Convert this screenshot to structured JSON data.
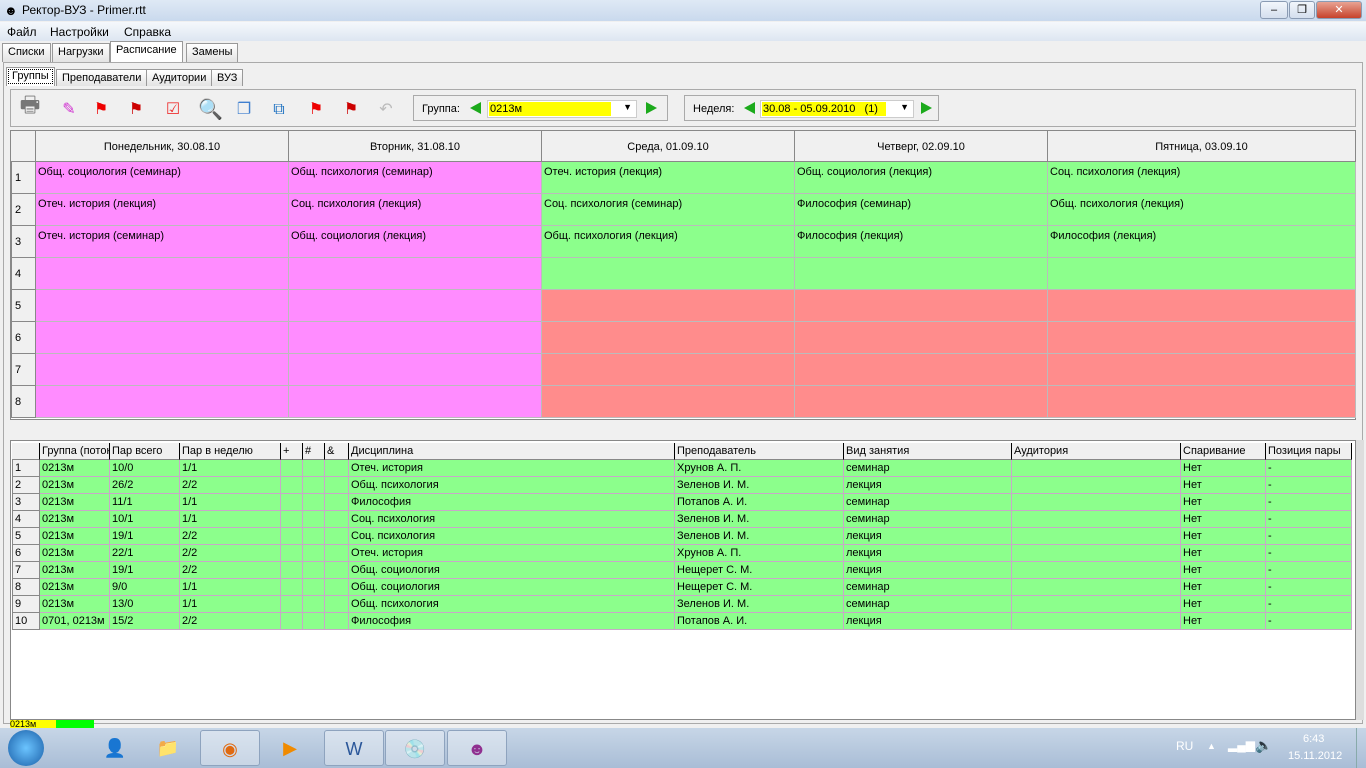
{
  "window": {
    "title": "Ректор-ВУЗ - Primer.rtt"
  },
  "menu": [
    "Файл",
    "Настройки",
    "Справка"
  ],
  "tabs": [
    "Списки",
    "Нагрузки",
    "Расписание",
    "Замены"
  ],
  "active_tab": "Расписание",
  "subtabs": [
    "Группы",
    "Преподаватели",
    "Аудитории",
    "ВУЗ"
  ],
  "active_subtab": "Группы",
  "toolbar": {
    "icons": [
      "printer-icon",
      "eraser-icon",
      "flag-icon",
      "flag-remove-icon",
      "checklist-icon",
      "magnifier-icon",
      "copy-icon",
      "export-window-icon",
      "flags-icon",
      "flags-remove-icon",
      "undo-icon"
    ],
    "group_label": "Группа:",
    "group_value": "0213м",
    "week_label": "Неделя:",
    "week_value": "30.08 - 05.09.2010   (1)"
  },
  "schedule": {
    "days": [
      "Понедельник, 30.08.10",
      "Вторник, 31.08.10",
      "Среда, 01.09.10",
      "Четверг, 02.09.10",
      "Пятница, 03.09.10"
    ],
    "rows": [
      "1",
      "2",
      "3",
      "4",
      "5",
      "6",
      "7",
      "8"
    ],
    "cells": [
      [
        "Общ. социология (семинар)",
        "Общ. психология (семинар)",
        "Отеч. история (лекция)",
        "Общ. социология (лекция)",
        "Соц. психология (лекция)"
      ],
      [
        "Отеч. история (лекция)",
        "Соц. психология (лекция)",
        "Соц. психология (семинар)",
        "Философия (семинар)",
        "Общ. психология (лекция)"
      ],
      [
        "Отеч. история (семинар)",
        "Общ. социология (лекция)",
        "Общ. психология (лекция)",
        "Философия (лекция)",
        "Философия (лекция)"
      ],
      [
        "",
        "",
        "",
        "",
        ""
      ],
      [
        "",
        "",
        "",
        "",
        ""
      ],
      [
        "",
        "",
        "",
        "",
        ""
      ],
      [
        "",
        "",
        "",
        "",
        ""
      ],
      [
        "",
        "",
        "",
        "",
        ""
      ]
    ],
    "colors": {
      "pink": "#ff8cff",
      "green": "#8cff8c",
      "red": "#ff8c8c"
    }
  },
  "table": {
    "headers": [
      "",
      "Группа (поток)",
      "Пар всего",
      "Пар в неделю",
      "+",
      "#",
      "&",
      "Дисциплина",
      "Преподаватель",
      "Вид занятия",
      "Аудитория",
      "Спаривание",
      "Позиция пары"
    ],
    "rows": [
      [
        "1",
        "0213м",
        "10/0",
        "1/1",
        "",
        "",
        "",
        "Отеч. история",
        "Хрунов А. П.",
        "семинар",
        "",
        "Нет",
        "-"
      ],
      [
        "2",
        "0213м",
        "26/2",
        "2/2",
        "",
        "",
        "",
        "Общ. психология",
        "Зеленов И. М.",
        "лекция",
        "",
        "Нет",
        "-"
      ],
      [
        "3",
        "0213м",
        "11/1",
        "1/1",
        "",
        "",
        "",
        "Философия",
        "Потапов А. И.",
        "семинар",
        "",
        "Нет",
        "-"
      ],
      [
        "4",
        "0213м",
        "10/1",
        "1/1",
        "",
        "",
        "",
        "Соц. психология",
        "Зеленов И. М.",
        "семинар",
        "",
        "Нет",
        "-"
      ],
      [
        "5",
        "0213м",
        "19/1",
        "2/2",
        "",
        "",
        "",
        "Соц. психология",
        "Зеленов И. М.",
        "лекция",
        "",
        "Нет",
        "-"
      ],
      [
        "6",
        "0213м",
        "22/1",
        "2/2",
        "",
        "",
        "",
        "Отеч. история",
        "Хрунов А. П.",
        "лекция",
        "",
        "Нет",
        "-"
      ],
      [
        "7",
        "0213м",
        "19/1",
        "2/2",
        "",
        "",
        "",
        "Общ. социология",
        "Нещерет С. М.",
        "лекция",
        "",
        "Нет",
        "-"
      ],
      [
        "8",
        "0213м",
        "9/0",
        "1/1",
        "",
        "",
        "",
        "Общ. социология",
        "Нещерет С. М.",
        "семинар",
        "",
        "Нет",
        "-"
      ],
      [
        "9",
        "0213м",
        "13/0",
        "1/1",
        "",
        "",
        "",
        "Общ. психология",
        "Зеленов И. М.",
        "семинар",
        "",
        "Нет",
        "-"
      ],
      [
        "10",
        "0701, 0213м",
        "15/2",
        "2/2",
        "",
        "",
        "",
        "Философия",
        "Потапов А. И.",
        "лекция",
        "",
        "Нет",
        "-"
      ]
    ]
  },
  "status": {
    "group": "0213м"
  },
  "taskbar": {
    "lang": "RU",
    "time": "6:43",
    "date": "15.11.2012"
  }
}
